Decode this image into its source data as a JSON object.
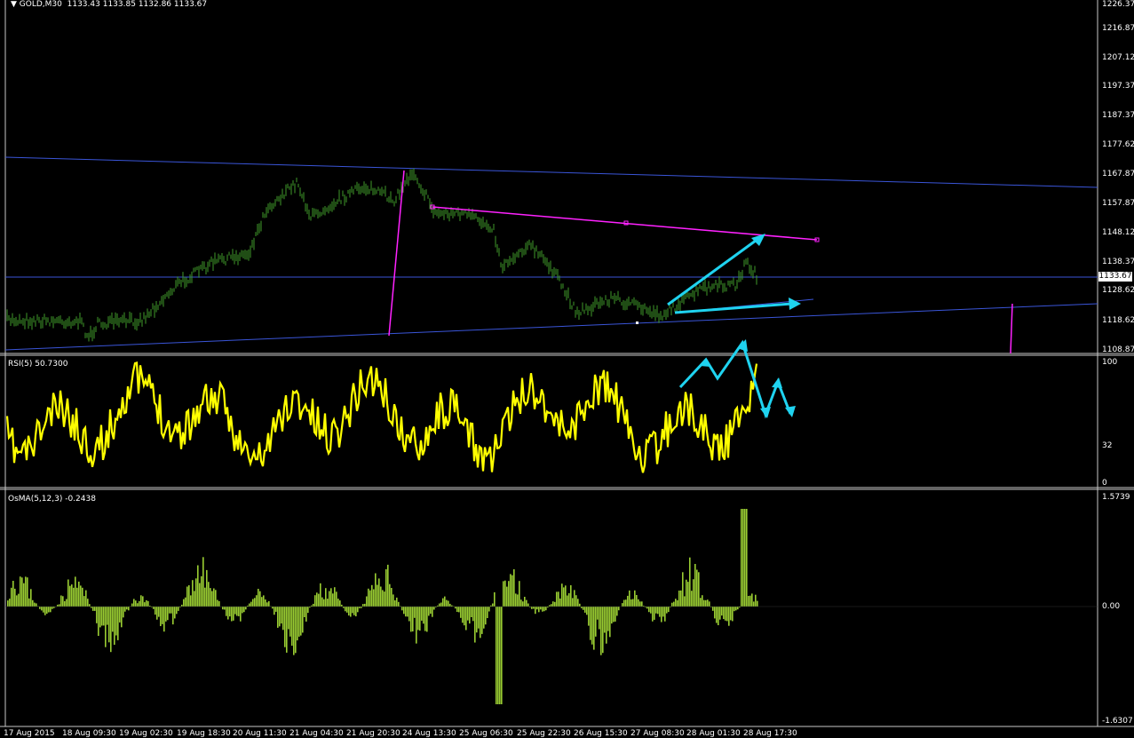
{
  "main": {
    "title": "GOLD,M30",
    "ohlc": [
      "1133.43",
      "1133.85",
      "1132.86",
      "1133.67"
    ],
    "price_axis": [
      "1226.37",
      "1216.87",
      "1207.12",
      "1197.37",
      "1187.37",
      "1177.62",
      "1167.87",
      "1157.87",
      "1148.12",
      "1138.37",
      "1128.62",
      "1118.62",
      "1108.87"
    ],
    "current_price": "1133.67"
  },
  "rsi": {
    "label": "RSI(5) 50.7300",
    "axis": [
      "100",
      "32",
      "0"
    ]
  },
  "osma": {
    "label": "OsMA(5,12,3) -0.2438",
    "axis": [
      "1.5739",
      "0.00",
      "-1.6307"
    ]
  },
  "time_axis": [
    "17 Aug 2015",
    "18 Aug 09:30",
    "19 Aug 02:30",
    "19 Aug 18:30",
    "20 Aug 11:30",
    "21 Aug 04:30",
    "21 Aug 20:30",
    "24 Aug 13:30",
    "25 Aug 06:30",
    "25 Aug 22:30",
    "26 Aug 15:30",
    "27 Aug 08:30",
    "28 Aug 01:30",
    "28 Aug 17:30"
  ],
  "colors": {
    "background": "#000000",
    "candles": "#3f9a2a",
    "channel": "#3a55d8",
    "trendline": "#ff22ff",
    "rsi_line": "#ffff00",
    "osma_bars": "#9acd32",
    "annotation": "#1fd3f0",
    "separator": "#c8c8c8"
  }
}
